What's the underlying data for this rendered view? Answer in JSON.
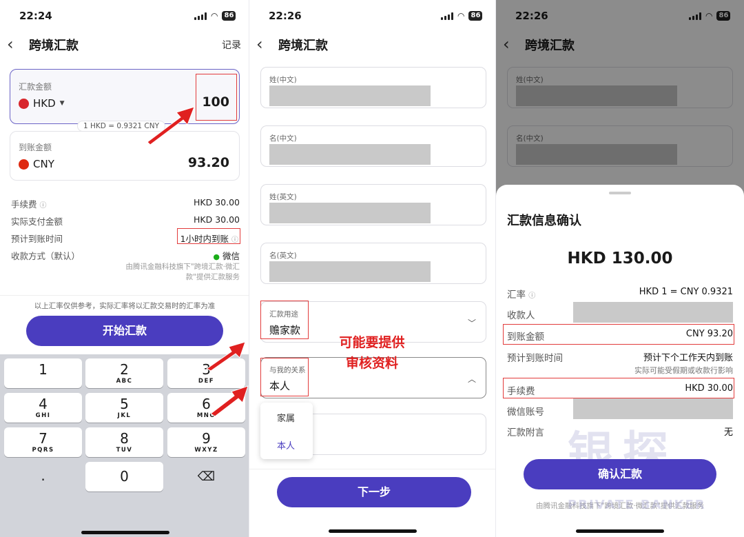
{
  "status": {
    "times": [
      "22:24",
      "22:26",
      "22:26"
    ],
    "battery": "86"
  },
  "screen1": {
    "title": "跨境汇款",
    "records_link": "记录",
    "send_label": "汇款金额",
    "send_currency": "HKD",
    "send_amount": "100",
    "rate_note": "1 HKD = 0.9321 CNY",
    "receive_label": "到账金额",
    "receive_currency": "CNY",
    "receive_amount": "93.20",
    "rows": [
      {
        "label": "手续费",
        "value": "HKD 30.00"
      },
      {
        "label": "实际支付金额",
        "value": "HKD 30.00"
      },
      {
        "label": "预计到账时间",
        "value": "1小时内到账"
      },
      {
        "label": "收款方式（默认）",
        "value": "微信"
      }
    ],
    "provider_note_1": "由腾讯金融科技旗下\"跨境汇款·微汇",
    "provider_note_2": "款\"提供汇款服务",
    "disclaimer": "以上汇率仅供参考，实际汇率将以汇款交易时的汇率为准",
    "start_button": "开始汇款",
    "keys": [
      {
        "num": "1",
        "letters": ""
      },
      {
        "num": "2",
        "letters": "ABC"
      },
      {
        "num": "3",
        "letters": "DEF"
      },
      {
        "num": "4",
        "letters": "GHI"
      },
      {
        "num": "5",
        "letters": "JKL"
      },
      {
        "num": "6",
        "letters": "MNO"
      },
      {
        "num": "7",
        "letters": "PQRS"
      },
      {
        "num": "8",
        "letters": "TUV"
      },
      {
        "num": "9",
        "letters": "WXYZ"
      },
      {
        "num": ".",
        "letters": ""
      },
      {
        "num": "0",
        "letters": ""
      }
    ]
  },
  "screen2": {
    "title": "跨境汇款",
    "field_labels": [
      "姓(中文)",
      "名(中文)",
      "姓(英文)",
      "名(英文)"
    ],
    "purpose_label": "汇款用途",
    "purpose_value": "赡家款",
    "relation_label": "与我的关系",
    "relation_value": "本人",
    "dropdown_options": [
      "家属",
      "本人"
    ],
    "annotation_line1": "可能要提供",
    "annotation_line2": "审核资料",
    "next_button": "下一步"
  },
  "screen3": {
    "title": "跨境汇款",
    "bg_field_labels": [
      "姓(中文)",
      "名(中文)"
    ],
    "sheet_title": "汇款信息确认",
    "total": "HKD 130.00",
    "rows": [
      {
        "label": "汇率",
        "value": "HKD 1 = CNY 0.9321"
      },
      {
        "label": "收款人",
        "value": ""
      },
      {
        "label": "到账金额",
        "value": "CNY 93.20"
      },
      {
        "label": "预计到账时间",
        "value": "预计下个工作天内到账"
      },
      {
        "label": "手续费",
        "value": "HKD 30.00"
      },
      {
        "label": "微信账号",
        "value": ""
      },
      {
        "label": "汇款附言",
        "value": "无"
      }
    ],
    "eta_note": "实际可能受假期或收款行影响",
    "confirm_button": "确认汇款",
    "footer": "由腾讯金融科技旗下\"跨境汇款·微汇款\"提供汇款服务",
    "watermark_cn": "银探",
    "watermark_en": "PRIVATE BANKER"
  },
  "colors": {
    "accent": "#4a3dbf",
    "annotation_red": "#e02020",
    "overlay": "rgba(0,0,0,0.45)"
  }
}
